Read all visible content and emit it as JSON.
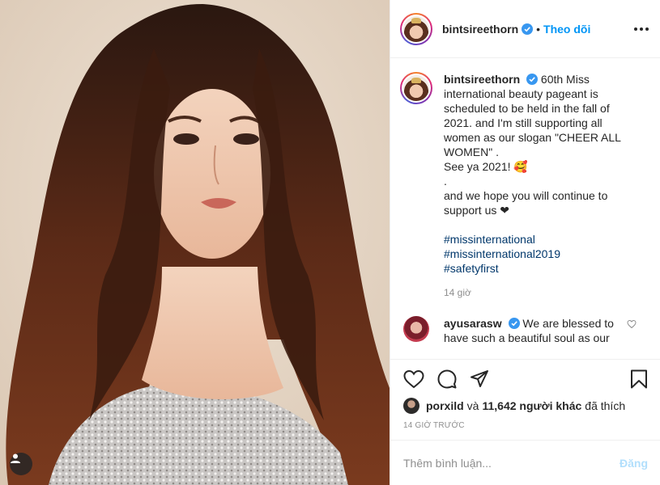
{
  "post": {
    "author": "bintsireethorn",
    "follow_label": "Theo dõi",
    "separator": "•",
    "caption": {
      "lines": [
        "60th Miss international beauty pageant is scheduled to be held in the fall of 2021. and I'm still supporting all women as our slogan \"CHEER ALL WOMEN\" .",
        "See ya 2021! 🥰",
        ".",
        "and we hope you will continue to support us ❤"
      ],
      "hashtags": [
        "#missinternational",
        "#missinternational2019",
        "#safetyfirst"
      ],
      "time": "14 giờ"
    },
    "comments": [
      {
        "author": "ayusarasw",
        "text": "We are blessed to have such a beautiful soul as our ...",
        "visible_text": "We are blessed to have such a beautiful soul as our"
      }
    ],
    "likes": {
      "first_liker": "porxild",
      "and_label": "và",
      "count_label": "11,642 người khác",
      "suffix": "đã thích"
    },
    "posted_ago": "14 GIỜ TRƯỚC",
    "add_comment_placeholder": "Thêm bình luận...",
    "post_button": "Đăng"
  },
  "icons": {
    "verified": "verified-badge-icon",
    "more": "more-options-icon",
    "like": "heart-icon",
    "comment": "comment-icon",
    "share": "share-icon",
    "save": "bookmark-icon",
    "tagged_users": "user-tag-icon"
  },
  "colors": {
    "link_blue": "#0095f6",
    "hashtag": "#00376b",
    "muted": "#8e8e8e",
    "post_disabled": "#b2dffc"
  }
}
